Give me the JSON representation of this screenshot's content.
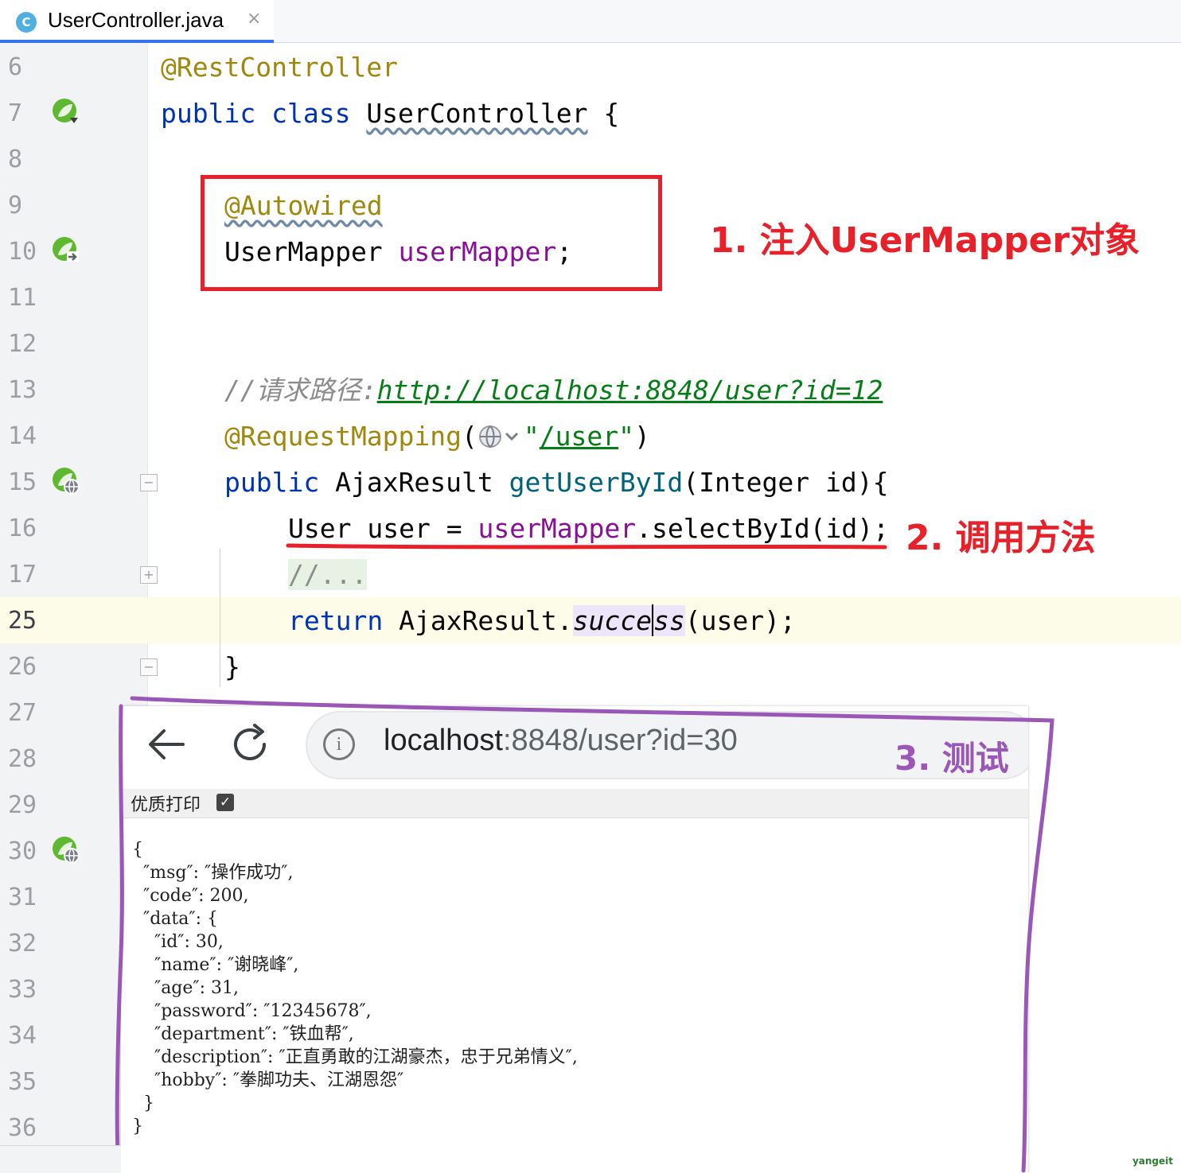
{
  "tab": {
    "icon_letter": "C",
    "title": "UserController.java",
    "close_glyph": "×"
  },
  "gutter": {
    "line_numbers": [
      "6",
      "7",
      "8",
      "9",
      "10",
      "11",
      "12",
      "13",
      "14",
      "15",
      "16",
      "17",
      "25",
      "26",
      "27",
      "28",
      "29",
      "30",
      "31",
      "32",
      "33",
      "34",
      "35",
      "36"
    ],
    "current_line": "25"
  },
  "code": {
    "l6": {
      "annotation": "@RestController"
    },
    "l7": {
      "kw1": "public",
      "kw2": "class",
      "name": "UserController",
      "brace": " {"
    },
    "l9": {
      "annotation": "@Autowired"
    },
    "l10": {
      "type": "UserMapper",
      "field": "userMapper",
      "semi": ";"
    },
    "l13": {
      "comment": "//请求路径:",
      "url": "http://localhost:8848/user?id=12"
    },
    "l14": {
      "annotation": "@RequestMapping",
      "open": "(",
      "quote1": "\"",
      "path": "/user",
      "quote2": "\"",
      "close": ")"
    },
    "l15": {
      "kw": "public",
      "type": "AjaxResult",
      "method": "getUserById",
      "params": "(Integer id){"
    },
    "l16": {
      "type": "User",
      "var": "user",
      "eq": " = ",
      "field": "userMapper",
      "call": ".selectById(id);"
    },
    "l17": {
      "folded": "//..."
    },
    "l25": {
      "kw": "return",
      "cls": "AjaxResult.",
      "method_a": "succe",
      "method_b": "ss",
      "args": "(user);"
    },
    "l26": {
      "brace": "}"
    }
  },
  "annotations": {
    "note1": "1. 注入UserMapper对象",
    "note2": "2. 调用方法",
    "note3": "3. 测试"
  },
  "browser": {
    "url_host": "localhost",
    "url_rest": ":8848/user?id=30",
    "pretty_print_label": "优质打印",
    "pretty_print_checked": "✓"
  },
  "json_lines": [
    "{",
    "  ″msg″: ″操作成功″,",
    "  ″code″: 200,",
    "  ″data″: {",
    "    ″id″: 30,",
    "    ″name″: ″谢晓峰″,",
    "    ″age″: 31,",
    "    ″password″: ″12345678″,",
    "    ″department″: ″铁血帮″,",
    "    ″description″: ″正直勇敢的江湖豪杰，忠于兄弟情义″,",
    "    ″hobby″: ″拳脚功夫、江湖恩怨″",
    "  }",
    "}"
  ],
  "watermark": "yangeit",
  "colors": {
    "keyword": "#0033b3",
    "annotation": "#9e880d",
    "field": "#871094",
    "highlight_red": "#e8202a",
    "highlight_purple": "#9b57b8"
  }
}
